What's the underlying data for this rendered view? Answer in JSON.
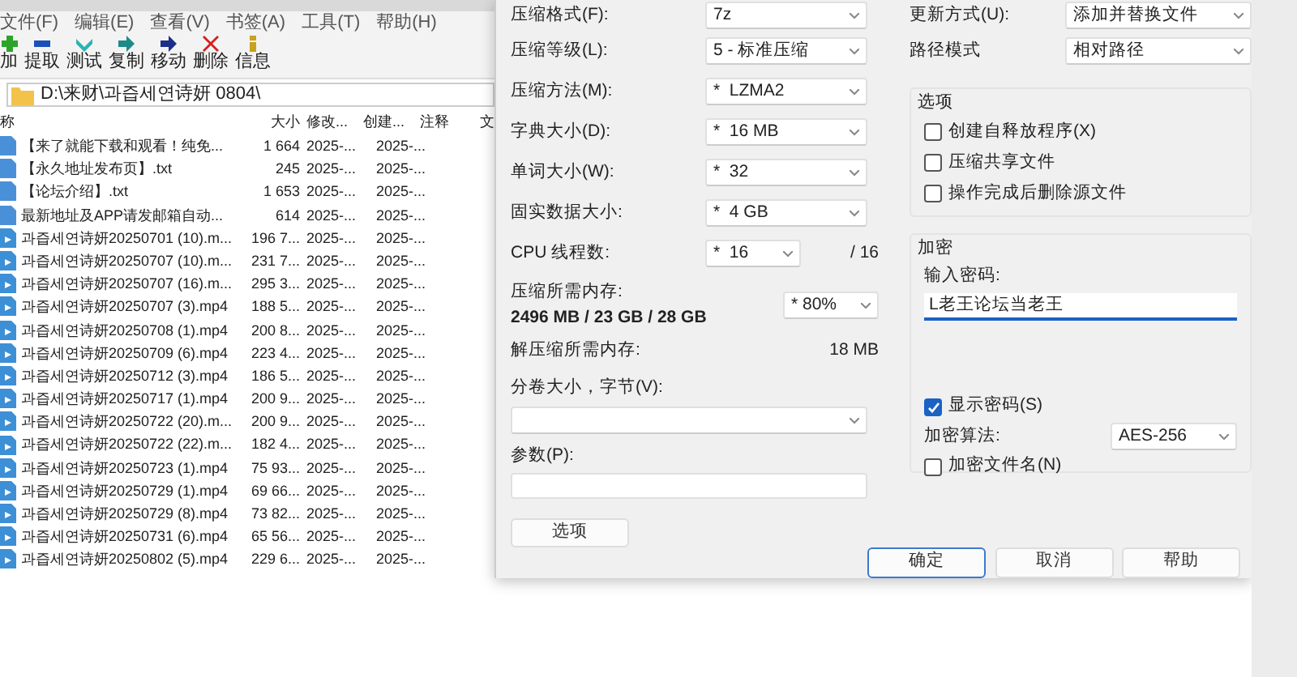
{
  "menu": [
    "文件(F)",
    "编辑(E)",
    "查看(V)",
    "书签(A)",
    "工具(T)",
    "帮助(H)"
  ],
  "toolbar": [
    {
      "label": "加",
      "kind": "add"
    },
    {
      "label": "提取",
      "kind": "extract"
    },
    {
      "label": "测试",
      "kind": "test"
    },
    {
      "label": "复制",
      "kind": "copy"
    },
    {
      "label": "移动",
      "kind": "move"
    },
    {
      "label": "删除",
      "kind": "delete"
    },
    {
      "label": "信息",
      "kind": "info"
    }
  ],
  "address": "D:\\来财\\과즙세연诗妍 0804\\",
  "columns": [
    "称",
    "大小",
    "修改...",
    "创建...",
    "注释",
    "文"
  ],
  "files": [
    {
      "name": "【来了就能下载和观看！纯免...",
      "size": "1 664",
      "modified": "2025-...",
      "created": "2025-...",
      "kind": "text"
    },
    {
      "name": "【永久地址发布页】.txt",
      "size": "245",
      "modified": "2025-...",
      "created": "2025-...",
      "kind": "text"
    },
    {
      "name": "【论坛介绍】.txt",
      "size": "1 653",
      "modified": "2025-...",
      "created": "2025-...",
      "kind": "text"
    },
    {
      "name": "最新地址及APP请发邮箱自动...",
      "size": "614",
      "modified": "2025-...",
      "created": "2025-...",
      "kind": "text"
    },
    {
      "name": "과즙세연诗妍20250701 (10).m...",
      "size": "196 7...",
      "modified": "2025-...",
      "created": "2025-...",
      "kind": "video"
    },
    {
      "name": "과즙세연诗妍20250707 (10).m...",
      "size": "231 7...",
      "modified": "2025-...",
      "created": "2025-...",
      "kind": "video"
    },
    {
      "name": "과즙세연诗妍20250707 (16).m...",
      "size": "295 3...",
      "modified": "2025-...",
      "created": "2025-...",
      "kind": "video"
    },
    {
      "name": "과즙세연诗妍20250707 (3).mp4",
      "size": "188 5...",
      "modified": "2025-...",
      "created": "2025-...",
      "kind": "video"
    },
    {
      "name": "과즙세연诗妍20250708 (1).mp4",
      "size": "200 8...",
      "modified": "2025-...",
      "created": "2025-...",
      "kind": "video"
    },
    {
      "name": "과즙세연诗妍20250709 (6).mp4",
      "size": "223 4...",
      "modified": "2025-...",
      "created": "2025-...",
      "kind": "video"
    },
    {
      "name": "과즙세연诗妍20250712 (3).mp4",
      "size": "186 5...",
      "modified": "2025-...",
      "created": "2025-...",
      "kind": "video"
    },
    {
      "name": "과즙세연诗妍20250717 (1).mp4",
      "size": "200 9...",
      "modified": "2025-...",
      "created": "2025-...",
      "kind": "video"
    },
    {
      "name": "과즙세연诗妍20250722 (20).m...",
      "size": "200 9...",
      "modified": "2025-...",
      "created": "2025-...",
      "kind": "video"
    },
    {
      "name": "과즙세연诗妍20250722 (22).m...",
      "size": "182 4...",
      "modified": "2025-...",
      "created": "2025-...",
      "kind": "video"
    },
    {
      "name": "과즙세연诗妍20250723 (1).mp4",
      "size": "75 93...",
      "modified": "2025-...",
      "created": "2025-...",
      "kind": "video"
    },
    {
      "name": "과즙세연诗妍20250729 (1).mp4",
      "size": "69 66...",
      "modified": "2025-...",
      "created": "2025-...",
      "kind": "video"
    },
    {
      "name": "과즙세연诗妍20250729 (8).mp4",
      "size": "73 82...",
      "modified": "2025-...",
      "created": "2025-...",
      "kind": "video"
    },
    {
      "name": "과즙세연诗妍20250731 (6).mp4",
      "size": "65 56...",
      "modified": "2025-...",
      "created": "2025-...",
      "kind": "video"
    },
    {
      "name": "과즙세연诗妍20250802 (5).mp4",
      "size": "229 6...",
      "modified": "2025-...",
      "created": "2025-...",
      "kind": "video"
    }
  ],
  "dialog": {
    "left": [
      {
        "kind": "select",
        "label": "压缩格式(F):",
        "value": "7z"
      },
      {
        "kind": "select",
        "label": "压缩等级(L):",
        "value": "5 - 标准压缩"
      },
      {
        "kind": "select",
        "label": "压缩方法(M):",
        "value": "*  LZMA2"
      },
      {
        "kind": "select",
        "label": "字典大小(D):",
        "value": "*  16 MB"
      },
      {
        "kind": "select",
        "label": "单词大小(W):",
        "value": "*  32"
      },
      {
        "kind": "select",
        "label": "固实数据大小:",
        "value": "*  4 GB"
      },
      {
        "kind": "cpu",
        "label": "CPU 线程数:",
        "value": "*  16",
        "suffix": "/ 16"
      },
      {
        "kind": "memory",
        "label": "压缩所需内存:",
        "detail": "2496 MB / 23 GB / 28 GB",
        "value": "* 80%"
      },
      {
        "kind": "info",
        "label": "解压缩所需内存:",
        "value": "18 MB"
      },
      {
        "kind": "stacked-select",
        "label": "分卷大小，字节(V):"
      },
      {
        "kind": "stacked-input",
        "label": "参数(P):"
      },
      {
        "kind": "button",
        "label": "选项"
      }
    ],
    "update_mode": {
      "label": "更新方式(U):",
      "value": "添加并替换文件"
    },
    "path_mode": {
      "label": "路径模式",
      "value": "相对路径"
    },
    "options": {
      "title": "选项",
      "checkboxes": [
        {
          "label": "创建自释放程序(X)",
          "checked": false
        },
        {
          "label": "压缩共享文件",
          "checked": false
        },
        {
          "label": "操作完成后删除源文件",
          "checked": false
        }
      ]
    },
    "encryption": {
      "title": "加密",
      "password_label": "输入密码:",
      "password": "L老王论坛当老王",
      "show_password": {
        "label": "显示密码(S)",
        "checked": true
      },
      "method": {
        "label": "加密算法:",
        "value": "AES-256"
      },
      "encrypt_names": {
        "label": "加密文件名(N)",
        "checked": false
      }
    },
    "buttons": [
      {
        "label": "确定",
        "default": true
      },
      {
        "label": "取消",
        "default": false
      },
      {
        "label": "帮助",
        "default": false
      }
    ]
  }
}
